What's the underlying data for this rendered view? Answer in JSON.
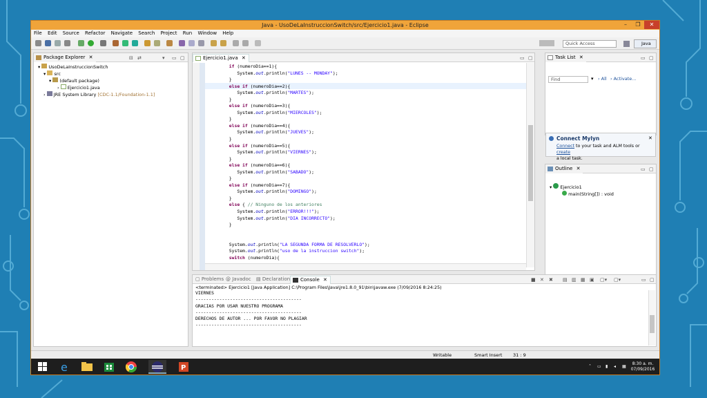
{
  "window": {
    "title": "Java - UsoDeLaInstruccionSwitch/src/Ejercicio1.java - Eclipse",
    "controls": [
      "–",
      "❐",
      "✕"
    ]
  },
  "menu": [
    "File",
    "Edit",
    "Source",
    "Refactor",
    "Navigate",
    "Search",
    "Project",
    "Run",
    "Window",
    "Help"
  ],
  "toolbar": {
    "quick_access_placeholder": "Quick Access",
    "perspective_label": "Java"
  },
  "package_explorer": {
    "tab_label": "Package Explorer",
    "tree": [
      {
        "label": "UsoDeLaInstruccionSwitch",
        "level": 0,
        "icon": "project-icon"
      },
      {
        "label": "src",
        "level": 1,
        "icon": "source-folder-icon"
      },
      {
        "label": "(default package)",
        "level": 2,
        "icon": "package-icon"
      },
      {
        "label": "Ejercicio1.java",
        "level": 3,
        "icon": "java-file-icon"
      },
      {
        "label": "JRE System Library",
        "suffix": "[CDC-1.1/Foundation-1.1]",
        "level": 1,
        "icon": "library-icon"
      }
    ]
  },
  "editor": {
    "tab_label": "Ejercicio1.java",
    "lines": [
      "        if (numeroDia==1){",
      "           System.out.println(\"LUNES -- MONDAY\");",
      "        }",
      "        else if (numeroDia==2){",
      "           System.out.println(\"MARTES\");",
      "        }",
      "        else if (numeroDia==3){",
      "           System.out.println(\"MIERCOLES\");",
      "        }",
      "        else if (numeroDia==4){",
      "           System.out.println(\"JUEVES\");",
      "        }",
      "        else if (numeroDia==5){",
      "           System.out.println(\"VIERNES\");",
      "        }",
      "        else if (numeroDia==6){",
      "           System.out.println(\"SABADO\");",
      "        }",
      "        else if (numeroDia==7){",
      "           System.out.println(\"DOMINGO\");",
      "        }",
      "        else { // Ninguno de los anteriores",
      "           System.out.println(\"ERROR!!!\");",
      "           System.out.println(\"DIA INCORRECTO\");",
      "        }",
      "",
      "",
      "        System.out.println(\"LA SEGUNDA FORMA DE RESOLVERLO\");",
      "        System.out.println(\"uso de la instruccion switch\");",
      "        switch (numeroDia){"
    ]
  },
  "task_list": {
    "tab_label": "Task List",
    "find_placeholder": "Find",
    "filter_all": "All",
    "filter_activate": "Activate..."
  },
  "mylyn": {
    "title": "Connect Mylyn",
    "text_connect": "Connect",
    "text_middle": " to your task and ALM tools or ",
    "text_create": "create",
    "text_end": "a local task."
  },
  "outline": {
    "tab_label": "Outline",
    "class_name": "Ejercicio1",
    "method_name": "main(String[]) : void"
  },
  "bottom_tabs": [
    "Problems",
    "Javadoc",
    "Declaration",
    "Console"
  ],
  "console": {
    "header": "<terminated> Ejercicio1 [Java Application] C:\\Program Files\\Java\\jre1.8.0_91\\bin\\javaw.exe (7/09/2016 8:24:25)",
    "lines": [
      "VIERNES",
      "----------------------------------------",
      "GRACIAS POR USAR NUESTRO PROGRAMA",
      "----------------------------------------",
      "DERECHOS DE AUTOR ... POR FAVOR NO PLAGIAR",
      "----------------------------------------"
    ]
  },
  "status": {
    "writable": "Writable",
    "insert_mode": "Smart Insert",
    "position": "31 : 9"
  },
  "taskbar": {
    "time": "8:30 a. m.",
    "date": "07/09/2016"
  },
  "colors": {
    "title_bar": "#f0a43a",
    "keyword": "#7f0055",
    "string": "#2a00ff",
    "field": "#0000c0",
    "comment": "#3f7f5f",
    "background": "#1f7fb4"
  }
}
